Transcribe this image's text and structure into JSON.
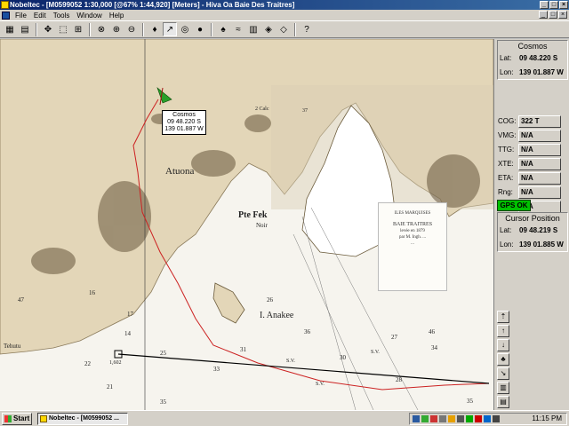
{
  "window": {
    "title": "Nobeltec - [M0599052 1:30,000 [@67% 1:44,920] [Meters] - Hiva Oa Baie Des Traitres]",
    "controls": [
      "_",
      "□",
      "×"
    ]
  },
  "menu": {
    "items": [
      "File",
      "Edit",
      "Tools",
      "Window",
      "Help"
    ]
  },
  "toolbar": {
    "buttons": [
      {
        "name": "chart-icon",
        "glyph": "▦"
      },
      {
        "name": "open-icon",
        "glyph": "▤"
      },
      {
        "name": "pan-icon",
        "glyph": "✥"
      },
      {
        "name": "select-icon",
        "glyph": "⬚"
      },
      {
        "name": "grid-icon",
        "glyph": "⊞"
      },
      {
        "name": "stop-icon",
        "glyph": "⊗"
      },
      {
        "name": "zoom-in-icon",
        "glyph": "⊕"
      },
      {
        "name": "zoom-out-icon",
        "glyph": "⊖"
      },
      {
        "name": "waypoint-icon",
        "glyph": "♦"
      },
      {
        "name": "route-icon",
        "glyph": "↗"
      },
      {
        "name": "range-ring-icon",
        "glyph": "◎"
      },
      {
        "name": "globe-icon",
        "glyph": "●"
      },
      {
        "name": "boat-icon",
        "glyph": "♠"
      },
      {
        "name": "tide-icon",
        "glyph": "≈"
      },
      {
        "name": "layers-icon",
        "glyph": "▥"
      },
      {
        "name": "overlay-icon",
        "glyph": "◈"
      },
      {
        "name": "info-icon",
        "glyph": "◇"
      },
      {
        "name": "help-icon",
        "glyph": "?"
      }
    ]
  },
  "chart": {
    "boat_label": {
      "name": "Cosmos",
      "lat": "09 48.220 S",
      "lon": "139 01.887 W"
    },
    "place_names": {
      "atuona": "Atuona",
      "pte_fek": "Pte Fek",
      "pte_noir": "Noir",
      "anakee": "I. Anakee",
      "tehutu": "Tehutu",
      "calc": "2 Calc"
    },
    "legend_lines": [
      "ILES MARQUISES",
      "BAIE TRAITRES",
      "levée en 1879",
      "par M. Ingh. ...",
      "..."
    ],
    "depths": [
      "37",
      "36",
      "47",
      "16",
      "17",
      "14",
      "21",
      "25",
      "22",
      "30",
      "28",
      "27",
      "46",
      "34",
      "35",
      "33",
      "31",
      "26",
      "35"
    ],
    "soundings_labels": [
      "S.V.",
      "S.V.",
      "S.V."
    ],
    "waypoint_label": "1,602",
    "colors": {
      "route": "#cc2222",
      "leg": "#000000",
      "boat": "#2aa02a"
    }
  },
  "panel": {
    "vessel": {
      "title": "Cosmos",
      "lat_label": "Lat:",
      "lat": "09 48.220 S",
      "lon_label": "Lon:",
      "lon": "139 01.887 W"
    },
    "nav": [
      {
        "label": "COG:",
        "value": "322 T"
      },
      {
        "label": "VMG:",
        "value": "N/A"
      },
      {
        "label": "TTG:",
        "value": "N/A"
      },
      {
        "label": "XTE:",
        "value": "N/A"
      },
      {
        "label": "ETA:",
        "value": "N/A"
      },
      {
        "label": "Rng:",
        "value": "N/A"
      },
      {
        "label": "Brg:",
        "value": "N/A"
      }
    ],
    "gps_status": "GPS OK",
    "cursor": {
      "title": "Cursor Position",
      "lat_label": "Lat:",
      "lat": "09 48.219 S",
      "lon_label": "Lon:",
      "lon": "139 01.885 W"
    }
  },
  "taskbar": {
    "start": "Start",
    "task": "Nobeltec - [M0599052 ...",
    "clock": "11:15 PM"
  }
}
